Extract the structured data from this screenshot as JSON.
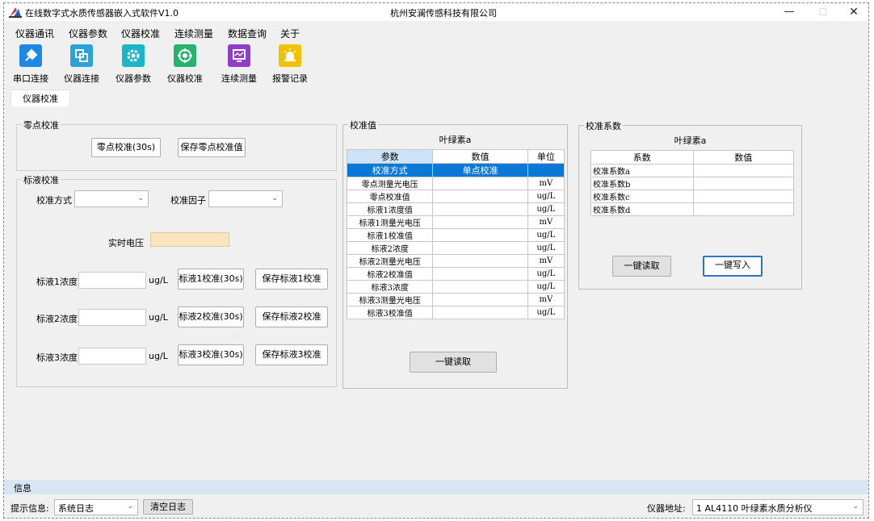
{
  "window": {
    "title": "在线数字式水质传感器嵌入式软件V1.0",
    "company": "杭州安澜传感科技有限公司",
    "min": "—",
    "max": "☐",
    "close": "✕"
  },
  "menu": [
    "仪器通讯",
    "仪器参数",
    "仪器校准",
    "连续测量",
    "数据查询",
    "关于"
  ],
  "toolbar": [
    {
      "label": "串口连接",
      "icon": "plug-icon",
      "color": "#1e88e5"
    },
    {
      "label": "仪器连接",
      "icon": "link-icon",
      "color": "#29a3d8"
    },
    {
      "label": "仪器参数",
      "icon": "gear-icon",
      "color": "#1ab5c7"
    },
    {
      "label": "仪器校准",
      "icon": "target-icon",
      "color": "#27b36b"
    },
    {
      "label": "连续测量",
      "icon": "monitor-icon",
      "color": "#8e3cc9"
    },
    {
      "label": "报警记录",
      "icon": "alarm-icon",
      "color": "#f2c200"
    }
  ],
  "tab": "仪器校准",
  "zero": {
    "title": "零点校准",
    "calibrate": "零点校准(30s)",
    "save": "保存零点校准值"
  },
  "std": {
    "title": "标液校准",
    "method_label": "校准方式",
    "method_value": "",
    "factor_label": "校准因子",
    "factor_value": "",
    "voltage_label": "实时电压",
    "rows": [
      {
        "label": "标液1浓度",
        "unit": "ug/L",
        "cal": "标液1校准(30s)",
        "save": "保存标液1校准"
      },
      {
        "label": "标液2浓度",
        "unit": "ug/L",
        "cal": "标液2校准(30s)",
        "save": "保存标液2校准"
      },
      {
        "label": "标液3浓度",
        "unit": "ug/L",
        "cal": "标液3校准(30s)",
        "save": "保存标液3校准"
      }
    ]
  },
  "calvalues": {
    "title": "校准值",
    "subtitle": "叶绿素a",
    "headers": [
      "参数",
      "数值",
      "单位"
    ],
    "rows": [
      {
        "param": "校准方式",
        "value": "单点校准",
        "unit": ""
      },
      {
        "param": "零点测量光电压",
        "value": "",
        "unit": "mV"
      },
      {
        "param": "零点校准值",
        "value": "",
        "unit": "ug/L"
      },
      {
        "param": "标液1浓度值",
        "value": "",
        "unit": "ug/L"
      },
      {
        "param": "标液1测量光电压",
        "value": "",
        "unit": "mV"
      },
      {
        "param": "标液1校准值",
        "value": "",
        "unit": "ug/L"
      },
      {
        "param": "标液2浓度",
        "value": "",
        "unit": "ug/L"
      },
      {
        "param": "标液2测量光电压",
        "value": "",
        "unit": "mV"
      },
      {
        "param": "标液2校准值",
        "value": "",
        "unit": "ug/L"
      },
      {
        "param": "标液3浓度",
        "value": "",
        "unit": "ug/L"
      },
      {
        "param": "标液3测量光电压",
        "value": "",
        "unit": "mV"
      },
      {
        "param": "标液3校准值",
        "value": "",
        "unit": "ug/L"
      }
    ],
    "read_button": "一键读取"
  },
  "coef": {
    "title": "校准系数",
    "subtitle": "叶绿素a",
    "headers": [
      "系数",
      "数值"
    ],
    "rows": [
      {
        "name": "校准系数a",
        "value": ""
      },
      {
        "name": "校准系数b",
        "value": ""
      },
      {
        "name": "校准系数c",
        "value": ""
      },
      {
        "name": "校准系数d",
        "value": ""
      }
    ],
    "read_button": "一键读取",
    "write_button": "一键写入"
  },
  "info": "信息",
  "status": {
    "hint_label": "提示信息:",
    "log_value": "系统日志",
    "clear_button": "清空日志",
    "address_label": "仪器地址:",
    "address_value": "1   AL4110 叶绿素水质分析仪"
  },
  "colors": {
    "selected_row": "#0a78d7",
    "header_highlight": "#cde3f7",
    "voltage_box": "#fae3bf",
    "info_bar": "#d7e6f2",
    "focus_border": "#2b73c8"
  }
}
